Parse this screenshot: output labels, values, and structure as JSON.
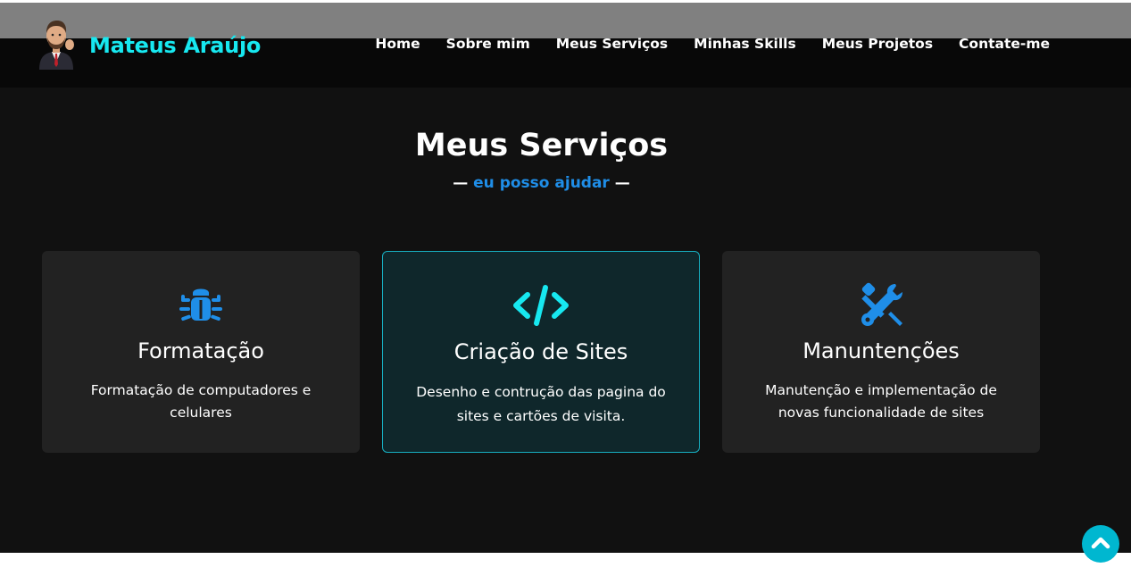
{
  "brand": {
    "name": "Mateus Araújo",
    "avatar_icon": "avatar-icon"
  },
  "nav": {
    "items": [
      {
        "label": "Home"
      },
      {
        "label": "Sobre mim"
      },
      {
        "label": "Meus Serviços"
      },
      {
        "label": "Minhas Skills"
      },
      {
        "label": "Meus Projetos"
      },
      {
        "label": "Contate-me"
      }
    ]
  },
  "services": {
    "title": "Meus Serviços",
    "subtitle_dash_left": "—",
    "subtitle": "eu posso ajudar",
    "subtitle_dash_right": "—",
    "cards": [
      {
        "icon": "bug-icon",
        "title": "Formatação",
        "description": "Formatação de computadores e celulares"
      },
      {
        "icon": "code-icon",
        "title": "Criação de Sites",
        "description": "Desenho e contrução das pagina do sites e cartões de visita."
      },
      {
        "icon": "tools-icon",
        "title": "Manuntenções",
        "description": "Manutenção e implementação de novas funcionalidade de sites"
      }
    ]
  },
  "scroll_top": {
    "icon": "chevron-up-icon"
  },
  "colors": {
    "brand_cyan": "#17e8f0",
    "accent_blue": "#1f8ee8",
    "scroll_button": "#00b7d0",
    "background": "#111111",
    "card": "#222222"
  }
}
